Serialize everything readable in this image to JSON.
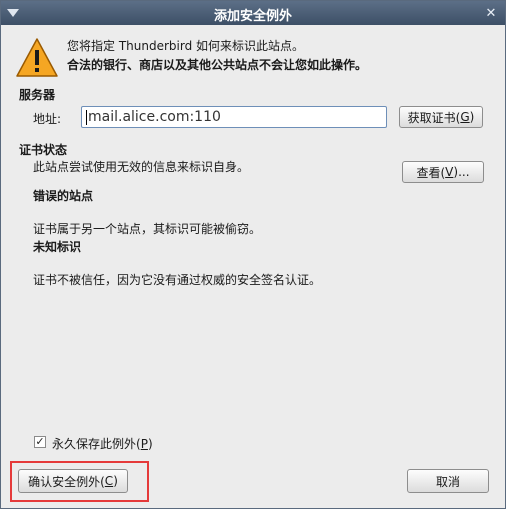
{
  "window": {
    "title": "添加安全例外",
    "close_glyph": "✕"
  },
  "warning": {
    "line1": "您将指定 Thunderbird 如何来标识此站点。",
    "line2": "合法的银行、商店以及其他公共站点不会让您如此操作。"
  },
  "server": {
    "heading": "服务器",
    "address_label": "地址:",
    "address_value": "mail.alice.com:110",
    "get_cert_text": "获取证书(",
    "get_cert_key": "G",
    "get_cert_close": ")"
  },
  "cert_status": {
    "heading": "证书状态",
    "description": "此站点尝试使用无效的信息来标识自身。",
    "view_text": "查看(",
    "view_key": "V",
    "view_close": ")...",
    "wrong_site_heading": "错误的站点",
    "wrong_site_text": "证书属于另一个站点，其标识可能被偷窃。",
    "unknown_heading": "未知标识",
    "unknown_text": "证书不被信任，因为它没有通过权威的安全签名认证。"
  },
  "permanent": {
    "label_text": "永久保存此例外(",
    "label_key": "P",
    "label_close": ")",
    "checked_glyph": "✓"
  },
  "footer": {
    "confirm_text": "确认安全例外(",
    "confirm_key": "C",
    "confirm_close": ")",
    "cancel": "取消"
  },
  "colors": {
    "highlight": "#e53a3a",
    "warning_fill": "#f5a623"
  }
}
